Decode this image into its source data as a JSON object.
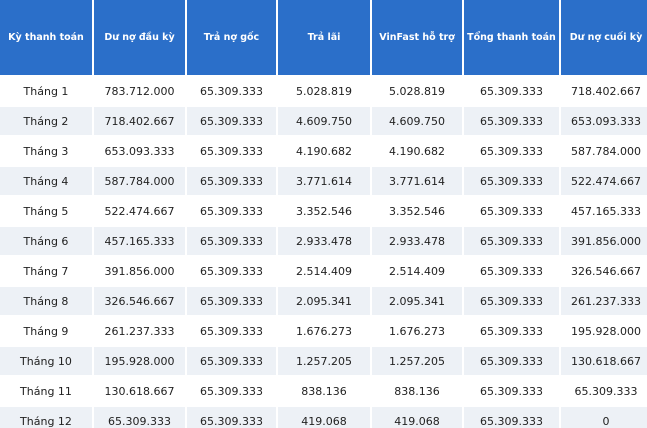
{
  "table": {
    "headers": [
      "Kỳ thanh toán",
      "Dư nợ đầu kỳ",
      "Trả nợ gốc",
      "Trả lãi",
      "VinFast hỗ trợ",
      "Tổng thanh toán",
      "Dư nợ cuối kỳ"
    ],
    "rows": [
      [
        "Tháng 1",
        "783.712.000",
        "65.309.333",
        "5.028.819",
        "5.028.819",
        "65.309.333",
        "718.402.667"
      ],
      [
        "Tháng 2",
        "718.402.667",
        "65.309.333",
        "4.609.750",
        "4.609.750",
        "65.309.333",
        "653.093.333"
      ],
      [
        "Tháng 3",
        "653.093.333",
        "65.309.333",
        "4.190.682",
        "4.190.682",
        "65.309.333",
        "587.784.000"
      ],
      [
        "Tháng 4",
        "587.784.000",
        "65.309.333",
        "3.771.614",
        "3.771.614",
        "65.309.333",
        "522.474.667"
      ],
      [
        "Tháng 5",
        "522.474.667",
        "65.309.333",
        "3.352.546",
        "3.352.546",
        "65.309.333",
        "457.165.333"
      ],
      [
        "Tháng 6",
        "457.165.333",
        "65.309.333",
        "2.933.478",
        "2.933.478",
        "65.309.333",
        "391.856.000"
      ],
      [
        "Tháng 7",
        "391.856.000",
        "65.309.333",
        "2.514.409",
        "2.514.409",
        "65.309.333",
        "326.546.667"
      ],
      [
        "Tháng 8",
        "326.546.667",
        "65.309.333",
        "2.095.341",
        "2.095.341",
        "65.309.333",
        "261.237.333"
      ],
      [
        "Tháng 9",
        "261.237.333",
        "65.309.333",
        "1.676.273",
        "1.676.273",
        "65.309.333",
        "195.928.000"
      ],
      [
        "Tháng 10",
        "195.928.000",
        "65.309.333",
        "1.257.205",
        "1.257.205",
        "65.309.333",
        "130.618.667"
      ],
      [
        "Tháng 11",
        "130.618.667",
        "65.309.333",
        "838.136",
        "838.136",
        "65.309.333",
        "65.309.333"
      ],
      [
        "Tháng 12",
        "65.309.333",
        "65.309.333",
        "419.068",
        "419.068",
        "65.309.333",
        "0"
      ]
    ]
  },
  "colors": {
    "header_bg": "#2b6fc9",
    "header_text": "#ffffff",
    "row_alt_bg": "#edf1f6",
    "cell_text": "#222222"
  }
}
